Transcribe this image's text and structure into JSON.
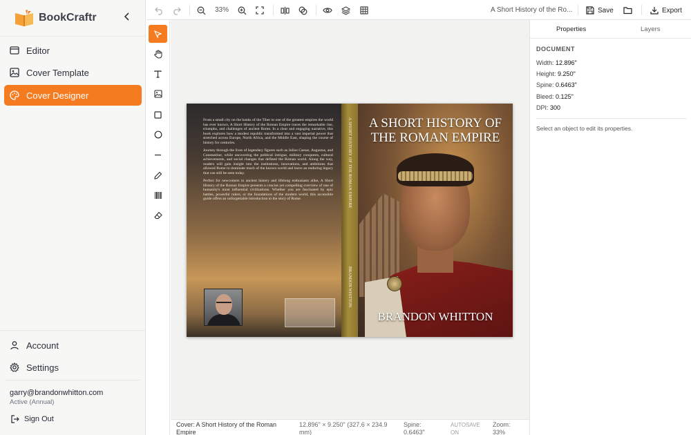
{
  "brand": {
    "name": "BookCraftr"
  },
  "sidebar": {
    "nav": [
      {
        "label": "Editor",
        "icon": "editor-icon"
      },
      {
        "label": "Cover Template",
        "icon": "image-icon"
      },
      {
        "label": "Cover Designer",
        "icon": "palette-icon",
        "active": true
      }
    ],
    "bottom": [
      {
        "label": "Account",
        "icon": "user-icon"
      },
      {
        "label": "Settings",
        "icon": "gear-icon"
      }
    ],
    "user": {
      "email": "garry@brandonwhitton.com",
      "status": "Active (Annual)"
    },
    "sign_out": "Sign Out"
  },
  "toolbar": {
    "zoom": "33%",
    "doc_title": "A Short History of the Ro...",
    "save_label": "Save",
    "export_label": "Export"
  },
  "cover": {
    "back_paragraphs": [
      "From a small city on the banks of the Tiber to one of the greatest empires the world has ever known, A Short History of the Roman Empire traces the remarkable rise, triumphs, and challenges of ancient Rome. In a clear and engaging narrative, this book explores how a modest republic transformed into a vast imperial power that stretched across Europe, North Africa, and the Middle East, shaping the course of history for centuries.",
      "Journey through the lives of legendary figures such as Julius Caesar, Augustus, and Constantine, while uncovering the political intrigue, military conquests, cultural achievements, and social changes that defined the Roman world. Along the way, readers will gain insight into the institutions, innovations, and ambitions that allowed Rome to dominate much of the known world and leave an enduring legacy that can still be seen today.",
      "Perfect for newcomers to ancient history and lifelong enthusiasts alike, A Short History of the Roman Empire presents a concise yet compelling overview of one of humanity's most influential civilizations. Whether you are fascinated by epic battles, powerful rulers, or the foundations of the modern world, this accessible guide offers an unforgettable introduction to the story of Rome."
    ],
    "spine_title": "A SHORT HISTORY OF THE ROMAN EMPIRE",
    "spine_author": "BRANDON WHITTON",
    "front_title_line1": "A SHORT HISTORY OF",
    "front_title_line2": "THE ROMAN EMPIRE",
    "front_author": "BRANDON WHITTON"
  },
  "status": {
    "name_line1": "Cover: A Short History of the Roman",
    "name_line2": "Empire",
    "size_line1": "12.896\" × 9.250\" (327.6 × 234.9",
    "size_line2": "mm)",
    "spine_line1": "Spine:",
    "spine_line2": "0.6463\"",
    "autosave_line1": "AUTOSAVE",
    "autosave_line2": "ON",
    "zoom_line1": "Zoom:",
    "zoom_line2": "33%"
  },
  "panel": {
    "tab_properties": "Properties",
    "tab_layers": "Layers",
    "section": "DOCUMENT",
    "rows": [
      {
        "label": "Width:",
        "value": "12.896\""
      },
      {
        "label": "Height:",
        "value": "9.250\""
      },
      {
        "label": "Spine:",
        "value": "0.6463\""
      },
      {
        "label": "Bleed:",
        "value": "0.125\""
      },
      {
        "label": "DPI:",
        "value": "300"
      }
    ],
    "hint": "Select an object to edit its properties."
  },
  "colors": {
    "accent": "#f47b20"
  }
}
